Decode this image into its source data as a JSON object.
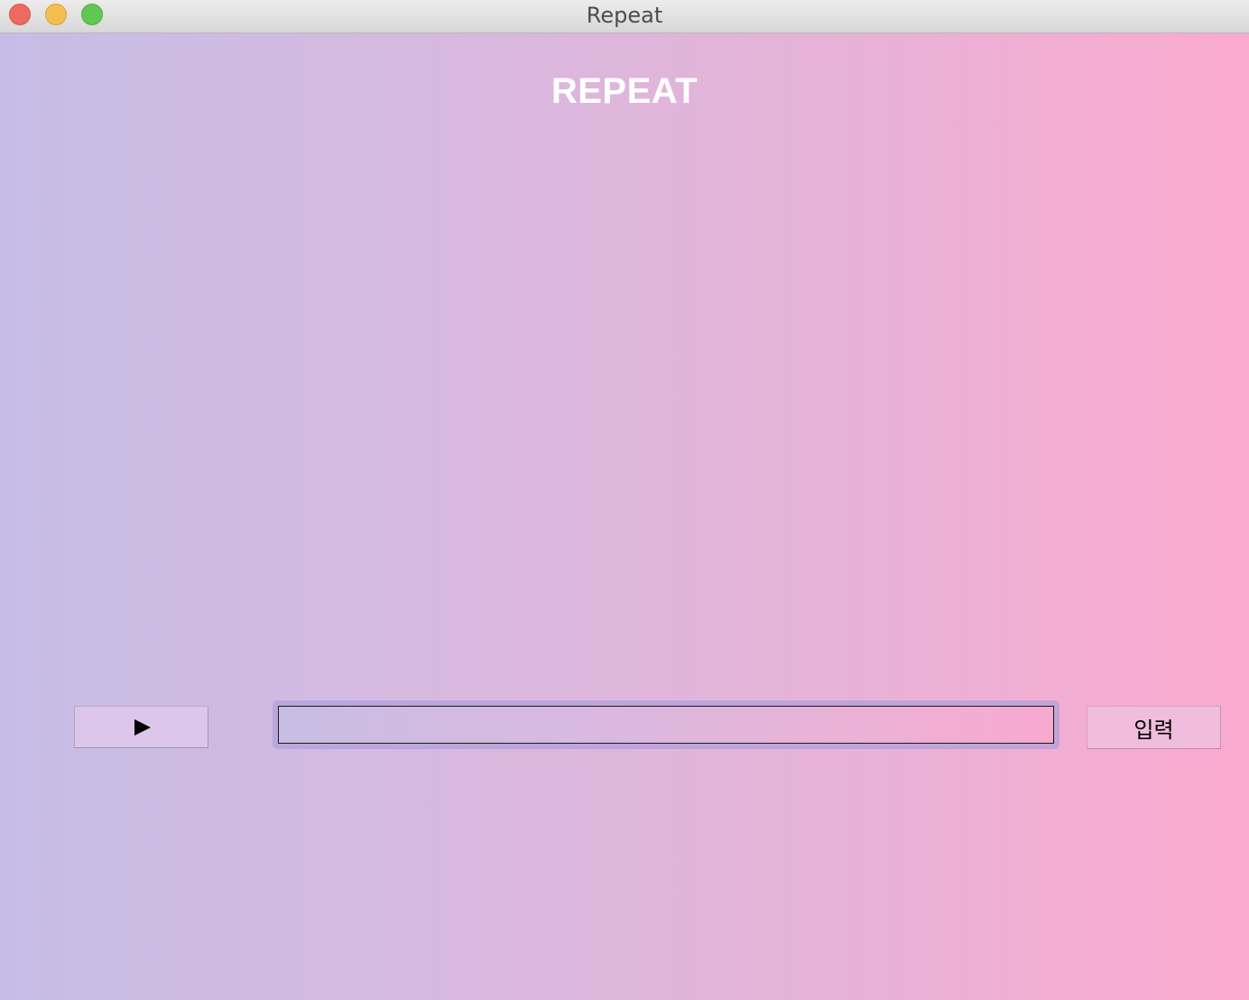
{
  "window": {
    "title": "Repeat"
  },
  "app": {
    "heading": "REPEAT"
  },
  "controls": {
    "play_icon": "play-icon",
    "input_value": "",
    "input_placeholder": "",
    "enter_label": "입력"
  },
  "colors": {
    "gradient_start": "#c6bde6",
    "gradient_end": "#fbaace",
    "heading": "#ffffff",
    "close": "#ee6a5f",
    "minimize": "#f5bf4f",
    "zoom": "#62c655"
  }
}
